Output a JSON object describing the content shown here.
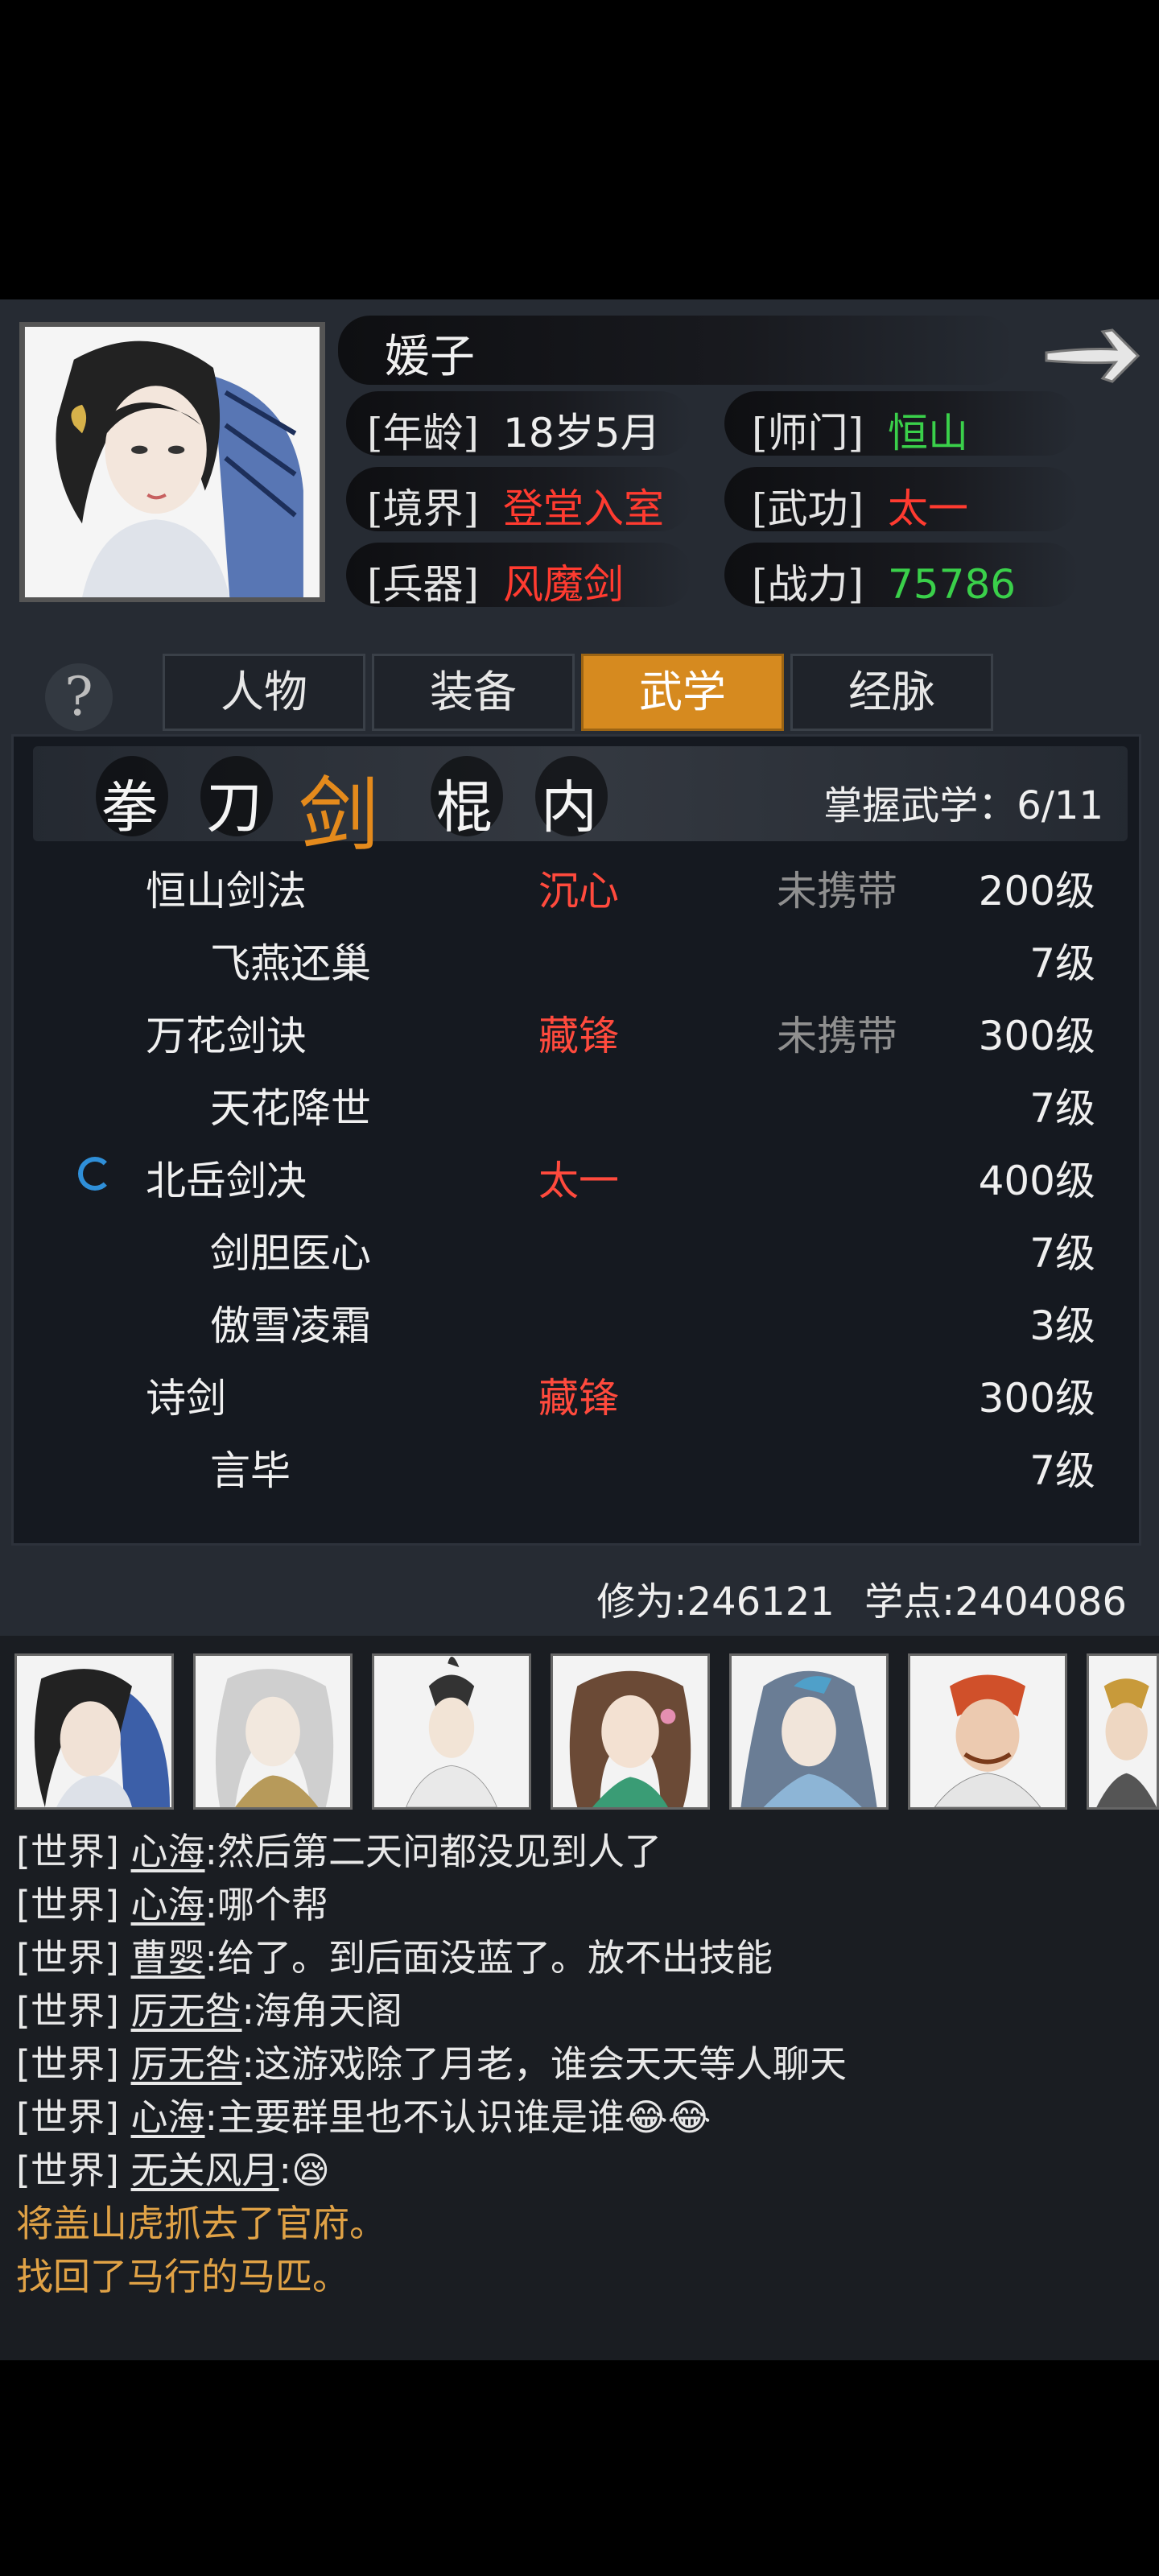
{
  "character": {
    "name": "媛子",
    "attributes": [
      {
        "key": "[年龄]",
        "value": "18岁5月",
        "color": "#eeeeee"
      },
      {
        "key": "[师门]",
        "value": "恒山",
        "color": "#3ad04a"
      },
      {
        "key": "[境界]",
        "value": "登堂入室",
        "color": "#ff3b30"
      },
      {
        "key": "[武功]",
        "value": "太一",
        "color": "#ff3b30"
      },
      {
        "key": "[兵器]",
        "value": "风魔剑",
        "color": "#ff3b30"
      },
      {
        "key": "[战力]",
        "value": "75786",
        "color": "#3ad04a"
      }
    ]
  },
  "tabs": [
    {
      "label": "人物",
      "active": false
    },
    {
      "label": "装备",
      "active": false
    },
    {
      "label": "武学",
      "active": true
    },
    {
      "label": "经脉",
      "active": false
    }
  ],
  "categories": [
    {
      "label": "拳",
      "active": false
    },
    {
      "label": "刀",
      "active": false
    },
    {
      "label": "剑",
      "active": true
    },
    {
      "label": "棍",
      "active": false
    },
    {
      "label": "内",
      "active": false
    }
  ],
  "mastery": "掌握武学：6/11",
  "skills": [
    {
      "name": "恒山剑法",
      "tag": "沉心",
      "carry": "未携带",
      "level": "200级",
      "sub": false
    },
    {
      "name": "飞燕还巢",
      "tag": "",
      "carry": "",
      "level": "7级",
      "sub": true
    },
    {
      "name": "万花剑诀",
      "tag": "藏锋",
      "carry": "未携带",
      "level": "300级",
      "sub": false
    },
    {
      "name": "天花降世",
      "tag": "",
      "carry": "",
      "level": "7级",
      "sub": true
    },
    {
      "name": "北岳剑决",
      "tag": "太一",
      "carry": "",
      "level": "400级",
      "sub": false,
      "equipped": true
    },
    {
      "name": "剑胆医心",
      "tag": "",
      "carry": "",
      "level": "7级",
      "sub": true
    },
    {
      "name": "傲雪凌霜",
      "tag": "",
      "carry": "",
      "level": "3级",
      "sub": true
    },
    {
      "name": "诗剑",
      "tag": "藏锋",
      "carry": "",
      "level": "300级",
      "sub": false
    },
    {
      "name": "言毕",
      "tag": "",
      "carry": "",
      "level": "7级",
      "sub": true
    }
  ],
  "stats": {
    "cultivation": "修为:246121",
    "points": "学点:2404086"
  },
  "chat": {
    "messages": [
      {
        "channel": "[世界]",
        "user": "心海",
        "text": ":然后第二天问都没见到人了"
      },
      {
        "channel": "[世界]",
        "user": "心海",
        "text": ":哪个帮"
      },
      {
        "channel": "[世界]",
        "user": "曹婴",
        "text": ":给了。到后面没蓝了。放不出技能"
      },
      {
        "channel": "[世界]",
        "user": "厉无咎",
        "text": ":海角天阁"
      },
      {
        "channel": "[世界]",
        "user": "厉无咎",
        "text": ":这游戏除了月老，谁会天天等人聊天"
      },
      {
        "channel": "[世界]",
        "user": "心海",
        "text": ":主要群里也不认识谁是谁😂😂"
      },
      {
        "channel": "[世界]",
        "user": "无关风月",
        "text": ":😪"
      }
    ],
    "system": [
      "将盖山虎抓去了官府。",
      "找回了马行的马匹。"
    ]
  },
  "colors": {
    "accent": "#d68a1f",
    "red": "#ff3b30",
    "green": "#3ad04a",
    "system": "#e0a246"
  }
}
